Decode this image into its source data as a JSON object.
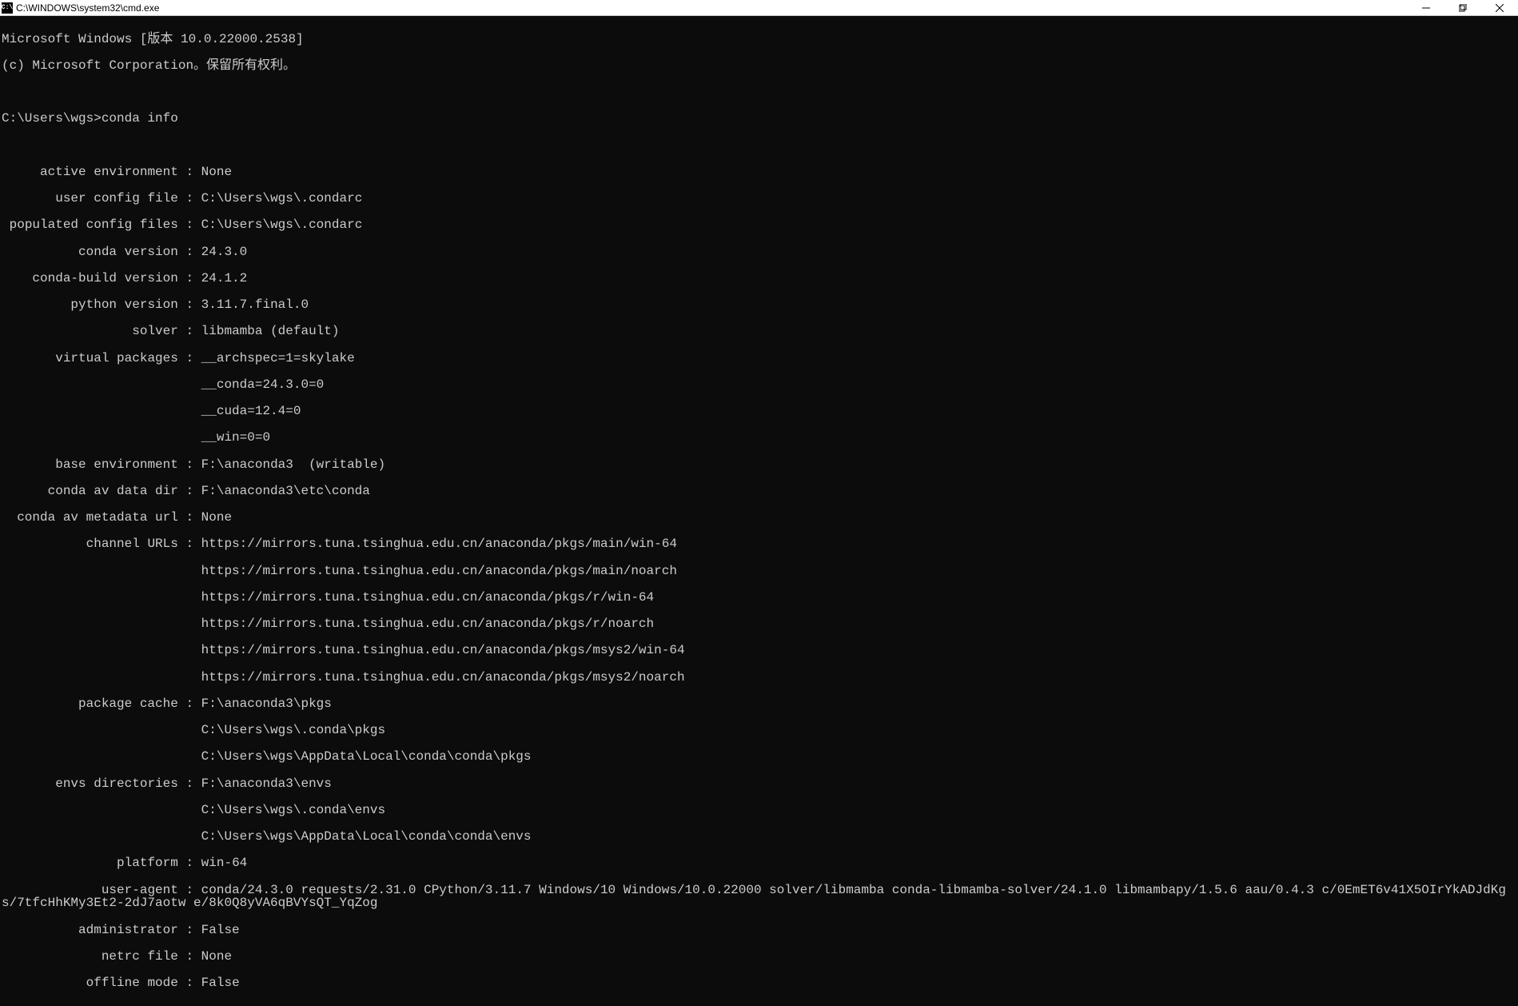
{
  "window": {
    "title": "C:\\WINDOWS\\system32\\cmd.exe",
    "icon_text": "C:\\"
  },
  "header": {
    "line1": "Microsoft Windows [版本 10.0.22000.2538]",
    "line2": "(c) Microsoft Corporation。保留所有权利。"
  },
  "prompt": {
    "text": "C:\\Users\\wgs>conda info"
  },
  "info": {
    "active_environment": {
      "label": "     active environment : ",
      "value": "None"
    },
    "user_config_file": {
      "label": "       user config file : ",
      "value": "C:\\Users\\wgs\\.condarc"
    },
    "populated_config_files": {
      "label": " populated config files : ",
      "value": "C:\\Users\\wgs\\.condarc"
    },
    "conda_version": {
      "label": "          conda version : ",
      "value": "24.3.0"
    },
    "conda_build_version": {
      "label": "    conda-build version : ",
      "value": "24.1.2"
    },
    "python_version": {
      "label": "         python version : ",
      "value": "3.11.7.final.0"
    },
    "solver": {
      "label": "                 solver : ",
      "value": "libmamba (default)"
    },
    "virtual_packages": {
      "label": "       virtual packages : ",
      "value0": "__archspec=1=skylake",
      "value1": "                          __conda=24.3.0=0",
      "value2": "                          __cuda=12.4=0",
      "value3": "                          __win=0=0"
    },
    "base_environment": {
      "label": "       base environment : ",
      "value": "F:\\anaconda3  (writable)"
    },
    "conda_av_data_dir": {
      "label": "      conda av data dir : ",
      "value": "F:\\anaconda3\\etc\\conda"
    },
    "conda_av_metadata_url": {
      "label": "  conda av metadata url : ",
      "value": "None"
    },
    "channel_urls": {
      "label": "           channel URLs : ",
      "value0": "https://mirrors.tuna.tsinghua.edu.cn/anaconda/pkgs/main/win-64",
      "value1": "                          https://mirrors.tuna.tsinghua.edu.cn/anaconda/pkgs/main/noarch",
      "value2": "                          https://mirrors.tuna.tsinghua.edu.cn/anaconda/pkgs/r/win-64",
      "value3": "                          https://mirrors.tuna.tsinghua.edu.cn/anaconda/pkgs/r/noarch",
      "value4": "                          https://mirrors.tuna.tsinghua.edu.cn/anaconda/pkgs/msys2/win-64",
      "value5": "                          https://mirrors.tuna.tsinghua.edu.cn/anaconda/pkgs/msys2/noarch"
    },
    "package_cache": {
      "label": "          package cache : ",
      "value0": "F:\\anaconda3\\pkgs",
      "value1": "                          C:\\Users\\wgs\\.conda\\pkgs",
      "value2": "                          C:\\Users\\wgs\\AppData\\Local\\conda\\conda\\pkgs"
    },
    "envs_directories": {
      "label": "       envs directories : ",
      "value0": "F:\\anaconda3\\envs",
      "value1": "                          C:\\Users\\wgs\\.conda\\envs",
      "value2": "                          C:\\Users\\wgs\\AppData\\Local\\conda\\conda\\envs"
    },
    "platform": {
      "label": "               platform : ",
      "value": "win-64"
    },
    "user_agent": {
      "label": "             user-agent : ",
      "value": "conda/24.3.0 requests/2.31.0 CPython/3.11.7 Windows/10 Windows/10.0.22000 solver/libmamba conda-libmamba-solver/24.1.0 libmambapy/1.5.6 aau/0.4.3 c/0EmET6v41X5OIrYkADJdKg s/7tfcHhKMy3Et2-2dJ7aotw e/8k0Q8yVA6qBVYsQT_YqZog"
    },
    "administrator": {
      "label": "          administrator : ",
      "value": "False"
    },
    "netrc_file": {
      "label": "             netrc file : ",
      "value": "None"
    },
    "offline_mode": {
      "label": "           offline mode : ",
      "value": "False"
    }
  }
}
